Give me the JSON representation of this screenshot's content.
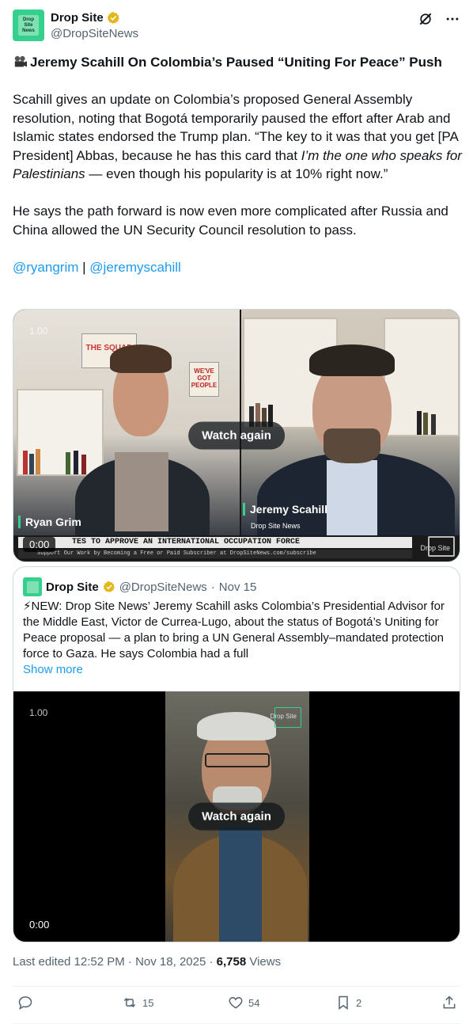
{
  "author": {
    "display_name": "Drop Site",
    "handle": "@DropSiteNews",
    "avatar_text": "Drop Site News"
  },
  "header_icons": [
    "grok-icon",
    "more-icon"
  ],
  "post": {
    "title": "Jeremy Scahill On Colombia’s Paused “Uniting For Peace” Push",
    "para1_start": "Scahill gives an update on Colombia’s proposed General Assembly resolution, noting that Bogotá temporarily paused the effort after Arab and Islamic states endorsed the Trump plan. “The key to it was that you get [PA President] Abbas, because he has this card that ",
    "para1_italic": "I’m the one who speaks for Palestinians",
    "para1_end": " — even though his popularity is at 10% right now.”",
    "para2": "He says the path forward is now even more complicated after Russia and China allowed the UN Security Council resolution to pass.",
    "mention1": "@ryangrim",
    "separator": "|",
    "mention2": "@jeremyscahill"
  },
  "video1": {
    "speed": "1.00",
    "watch_again": "Watch again",
    "time": "0:00",
    "left_name": "Ryan Grim",
    "right_name": "Jeremy Scahill",
    "right_sub": "Drop Site News",
    "ticker": "TES TO APPROVE AN INTERNATIONAL OCCUPATION FORCE",
    "ticker_sub": "Support Our Work by Becoming a Free or Paid Subscriber at DropSiteNews.com/subscribe",
    "watermark": "Drop Site",
    "poster_top": "THE SQUAD",
    "poster_right": "WE'VE GOT PEOPLE"
  },
  "quoted": {
    "display_name": "Drop Site",
    "handle": "@DropSiteNews",
    "date": "Nov 15",
    "dot": "·",
    "text": "⚡NEW: Drop Site News’ Jeremy Scahill asks Colombia’s Presidential Advisor for the Middle East, Victor de Currea-Lugo, about the status of Bogotá’s Uniting for Peace proposal — a plan to bring a UN General Assembly–mandated protection force to Gaza. He says Colombia had a full",
    "show_more": "Show more",
    "video": {
      "speed": "1.00",
      "watch_again": "Watch again",
      "time": "0:00",
      "watermark": "Drop Site"
    }
  },
  "meta": {
    "edited": "Last edited 12:52 PM · Nov 18, 2025 · ",
    "views_count": "6,758",
    "views_label": " Views"
  },
  "actions": {
    "replies": "",
    "reposts": "15",
    "likes": "54",
    "bookmarks": "2"
  },
  "colors": {
    "accent": "#1d9bf0",
    "brand": "#35d08d",
    "verified": "#e2b719"
  }
}
